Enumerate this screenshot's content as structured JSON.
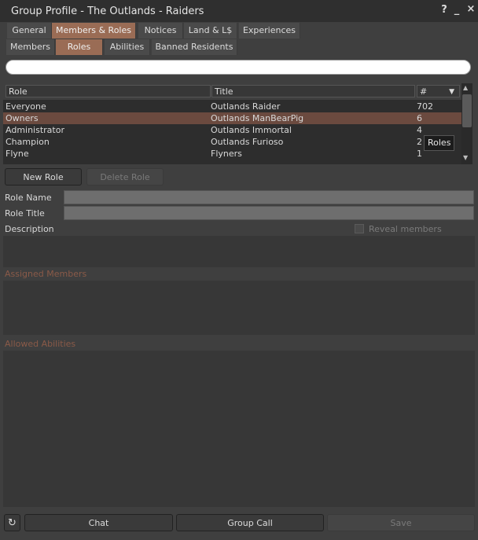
{
  "window": {
    "title": "Group Profile - The Outlands - Raiders"
  },
  "title_controls": {
    "help": "?",
    "minimize": "_",
    "close": "×"
  },
  "main_tabs": [
    {
      "label": "General",
      "active": false
    },
    {
      "label": "Members & Roles",
      "active": true
    },
    {
      "label": "Notices",
      "active": false
    },
    {
      "label": "Land & L$",
      "active": false
    },
    {
      "label": "Experiences",
      "active": false
    }
  ],
  "sub_tabs": [
    {
      "label": "Members",
      "active": false
    },
    {
      "label": "Roles",
      "active": true
    },
    {
      "label": "Abilities",
      "active": false
    },
    {
      "label": "Banned Residents",
      "active": false
    }
  ],
  "search": {
    "value": ""
  },
  "roles_table": {
    "columns": {
      "role": "Role",
      "title": "Title",
      "count": "#"
    },
    "rows": [
      {
        "role": "Everyone",
        "title": "Outlands Raider",
        "count": "702",
        "selected": false
      },
      {
        "role": "Owners",
        "title": "Outlands ManBearPig",
        "count": "6",
        "selected": true
      },
      {
        "role": "Administrator",
        "title": "Outlands Immortal",
        "count": "4",
        "selected": false
      },
      {
        "role": "Champion",
        "title": "Outlands Furioso",
        "count": "2",
        "selected": false
      },
      {
        "role": "Flyne",
        "title": "Flyners",
        "count": "1",
        "selected": false
      }
    ],
    "tooltip": "Roles"
  },
  "buttons": {
    "new_role": "New Role",
    "delete_role": "Delete Role"
  },
  "form": {
    "role_name_label": "Role Name",
    "role_name_value": "",
    "role_title_label": "Role Title",
    "role_title_value": "",
    "description_label": "Description",
    "reveal_members_label": "Reveal members"
  },
  "sections": {
    "assigned_members": "Assigned Members",
    "allowed_abilities": "Allowed Abilities"
  },
  "footer": {
    "chat": "Chat",
    "group_call": "Group Call",
    "save": "Save"
  },
  "colors": {
    "accent": "#9a6c55",
    "selected_row": "#6b4a3f",
    "section_title": "#8a5a48"
  }
}
